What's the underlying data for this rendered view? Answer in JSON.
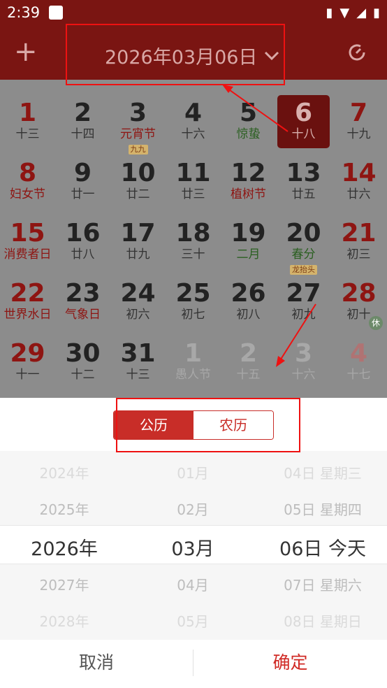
{
  "status_bar": {
    "time": "2:39"
  },
  "header": {
    "title": "2026年03月06日"
  },
  "calendar": {
    "rows": [
      [
        {
          "d": "1",
          "l": "十三",
          "red": true
        },
        {
          "d": "2",
          "l": "十四"
        },
        {
          "d": "3",
          "l": "元宵节",
          "lr": "red",
          "tag": "九九"
        },
        {
          "d": "4",
          "l": "十六"
        },
        {
          "d": "5",
          "l": "惊蛰",
          "lr": "green"
        },
        {
          "d": "6",
          "l": "十八",
          "sel": true
        },
        {
          "d": "7",
          "l": "十九",
          "red": true
        }
      ],
      [
        {
          "d": "8",
          "l": "妇女节",
          "red": true,
          "lr": "red"
        },
        {
          "d": "9",
          "l": "廿一"
        },
        {
          "d": "10",
          "l": "廿二"
        },
        {
          "d": "11",
          "l": "廿三"
        },
        {
          "d": "12",
          "l": "植树节",
          "lr": "red"
        },
        {
          "d": "13",
          "l": "廿五"
        },
        {
          "d": "14",
          "l": "廿六",
          "red": true
        }
      ],
      [
        {
          "d": "15",
          "l": "消费者日",
          "red": true,
          "lr": "red"
        },
        {
          "d": "16",
          "l": "廿八"
        },
        {
          "d": "17",
          "l": "廿九"
        },
        {
          "d": "18",
          "l": "三十"
        },
        {
          "d": "19",
          "l": "二月",
          "lr": "green"
        },
        {
          "d": "20",
          "l": "春分",
          "lr": "green",
          "tag": "龙抬头"
        },
        {
          "d": "21",
          "l": "初三",
          "red": true
        }
      ],
      [
        {
          "d": "22",
          "l": "世界水日",
          "red": true,
          "lr": "red"
        },
        {
          "d": "23",
          "l": "气象日",
          "lr": "red"
        },
        {
          "d": "24",
          "l": "初六"
        },
        {
          "d": "25",
          "l": "初七"
        },
        {
          "d": "26",
          "l": "初八"
        },
        {
          "d": "27",
          "l": "初九"
        },
        {
          "d": "28",
          "l": "初十",
          "red": true
        }
      ],
      [
        {
          "d": "29",
          "l": "十一",
          "red": true
        },
        {
          "d": "30",
          "l": "十二"
        },
        {
          "d": "31",
          "l": "十三"
        },
        {
          "d": "1",
          "l": "愚人节",
          "dim": true,
          "lr": "red"
        },
        {
          "d": "2",
          "l": "十五",
          "dim": true
        },
        {
          "d": "3",
          "l": "十六",
          "dim": true
        },
        {
          "d": "4",
          "l": "十七",
          "dim": true,
          "red": true,
          "rest": "休"
        }
      ]
    ]
  },
  "sheet": {
    "tabs": [
      "公历",
      "农历"
    ],
    "years": [
      "2024年",
      "2025年",
      "2026年",
      "2027年",
      "2028年"
    ],
    "months": [
      "01月",
      "02月",
      "03月",
      "04月",
      "05月"
    ],
    "days": [
      "04日 星期三",
      "05日 星期四",
      "06日 今天",
      "07日 星期六",
      "08日 星期日"
    ],
    "cancel": "取消",
    "confirm": "确定"
  }
}
